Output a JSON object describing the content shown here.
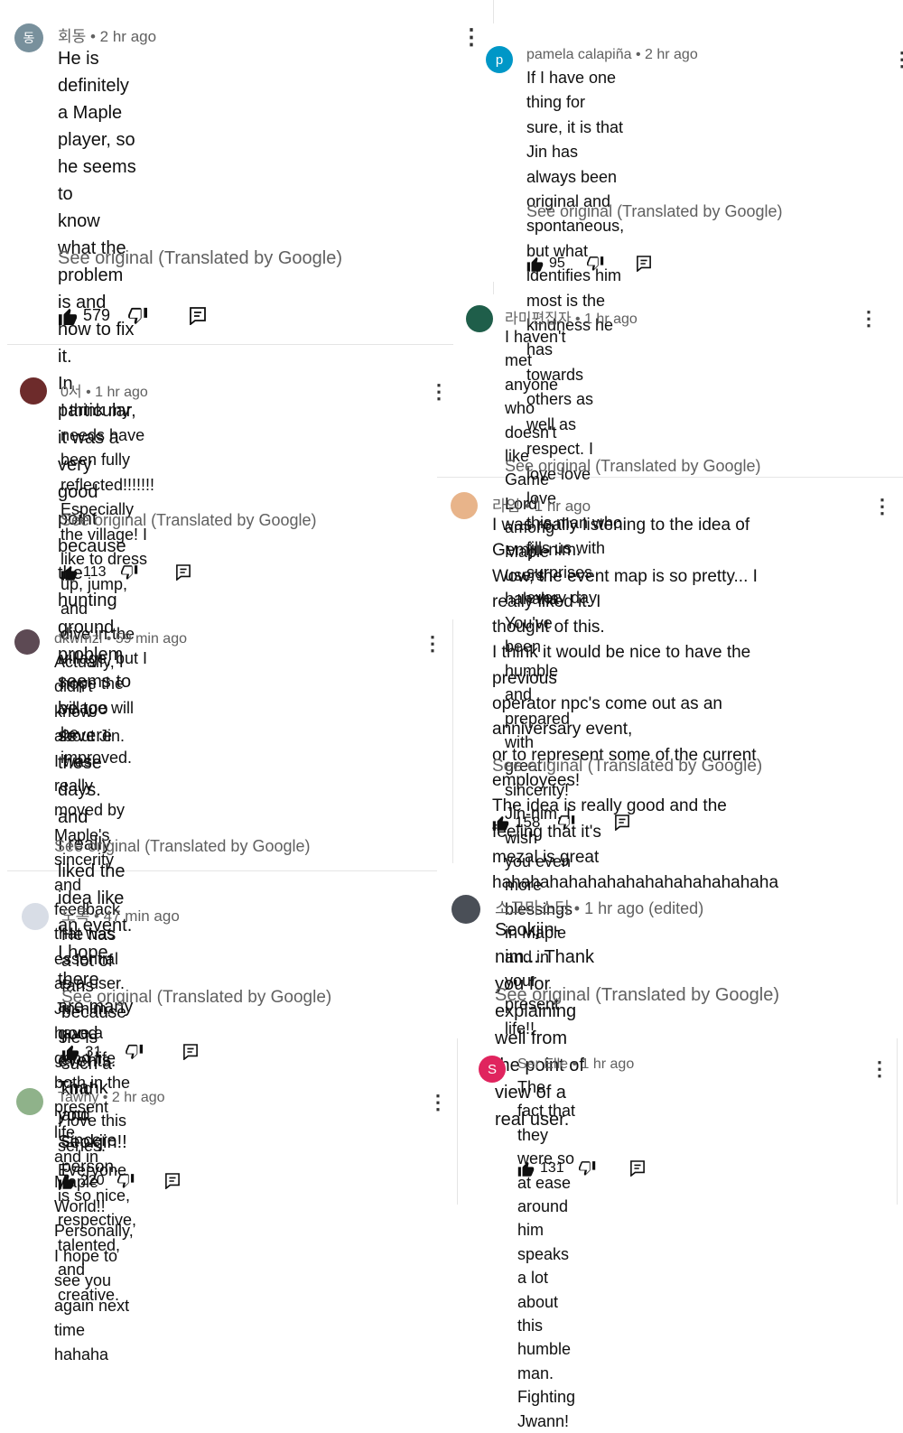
{
  "see_original": "See original (Translated by Google)",
  "comments": [
    {
      "author": "회동",
      "time": "2 hr ago",
      "meta": "회동 • 2 hr ago",
      "avatar_letter": "동",
      "avatar_color": "#78909c",
      "text": "He is definitely a Maple player, so he seems to\nknow what the problem is and how to fix it.\nIn particular, it was a very good point because the\nhunting ground problem seems to be too severe\nthese days. and\nI really liked the idea like an event. I hope there\nare many good events. Thank you Seokjin!!",
      "likes": "579"
    },
    {
      "author": "0서",
      "time": "1 hr ago",
      "meta": "0서 • 1 hr ago",
      "avatar_letter": "",
      "avatar_color": "#6d2b2b",
      "text": "I think my needs have been fully reflected!!!!!!!\nEspecially the village! I like to dress up, jump, and\ndive in the village, but I hope the village will be\nimproved.",
      "likes": "113"
    },
    {
      "author": "dkwmzl",
      "time": "59 min ago",
      "meta": "dkwmzl • 59 min ago",
      "avatar_letter": "",
      "avatar_color": "#5d4a54",
      "text": "Actually, I didn't know about Jin.\nI was really moved by Maple's sincerity and\nfeedback that was essential as a user.\nJin-nim, have a good life both in the present life\nand in Maple World!!\nPersonally, I hope to see you again next time\nhahaha",
      "likes": ""
    },
    {
      "author": "도록",
      "time": "47 min ago",
      "meta": "도록 • 47 min ago",
      "avatar_letter": "",
      "avatar_color": "#d8dde6",
      "text": "He has a lot of fans because he is such a kind\nand sincere person.",
      "likes": "31"
    },
    {
      "author": "Tawny",
      "time": "2 hr ago",
      "meta": "Tawny • 2 hr ago",
      "avatar_letter": "",
      "avatar_color": "#8fb28a",
      "text": "I love this series. Everyone is so nice, respective,\ntalented, and creative.",
      "likes": "220"
    },
    {
      "author": "pamela calapiña",
      "time": "2 hr ago",
      "meta": "pamela calapiña • 2 hr ago",
      "avatar_letter": "p",
      "avatar_color": "#0097c7",
      "text": "If I have one thing for sure, it is that Jin has\nalways been original and spontaneous, but what\nidentifies him most is the kindness he has\ntowards others as well as respect. I love love love\nthis man who fills us with surprises every day",
      "likes": "95"
    },
    {
      "author": "라미편집자",
      "time": "1 hr ago",
      "meta": "라미편집자 • 1 hr ago",
      "avatar_letter": "",
      "avatar_color": "#1f5e4a",
      "text": "I haven't met anyone who doesn't like Game Lord\namong Maple users hahaha You've been humble\nand prepared with great sincerity! Jin-nim, I wish\nyou even more blessings in Maple and in your\npresent life!!",
      "likes": ""
    },
    {
      "author": "라임",
      "time": "1 hr ago",
      "meta": "라임 • 1 hr ago",
      "avatar_letter": "",
      "avatar_color": "#e8b48a",
      "text": "I was really listening to the idea of Gemju-nim.\nWow, the event map is so pretty... I really liked it. I\nthought of this.\nI think it would be nice to have the previous\noperator npc's come out as an anniversary event,\nor to represent some of the current employees!\nThe idea is really good and the feeling that it's\nmezal is great\nhahahahahahahahahahahahahahaha",
      "likes": "158"
    },
    {
      "author": "소고마스터",
      "time": "1 hr ago (edited)",
      "meta": "소고마스터 • 1 hr ago (edited)",
      "avatar_letter": "",
      "avatar_color": "#4a4f57",
      "text": "Seokjin-nim....Thank you for explaining well from\nthe point of view of a real user.",
      "likes": ""
    },
    {
      "author": "Ser Elle",
      "time": "1 hr ago",
      "meta": "Ser Elle • 1 hr ago",
      "avatar_letter": "S",
      "avatar_color": "#e0245e",
      "text": "The fact that they were so at ease around him\nspeaks a lot about this humble man. Fighting\nJwann!",
      "likes": "131"
    }
  ],
  "icons": {
    "like": "thumbs-up-icon",
    "dislike": "thumbs-down-icon",
    "reply": "reply-icon",
    "more": "more-vert-icon"
  }
}
